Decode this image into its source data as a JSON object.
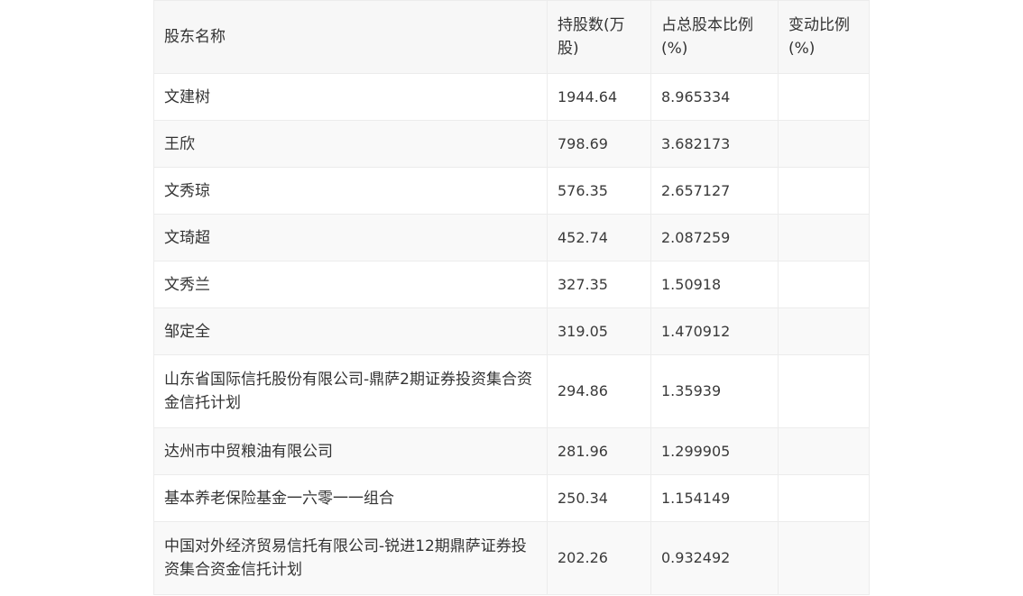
{
  "table": {
    "headers": {
      "name": "股东名称",
      "shares": "持股数(万股)",
      "ratio": "占总股本比例(%)",
      "change": "变动比例(%)"
    },
    "rows": [
      {
        "name": "文建树",
        "shares": "1944.64",
        "ratio": "8.965334",
        "change": ""
      },
      {
        "name": "王欣",
        "shares": "798.69",
        "ratio": "3.682173",
        "change": ""
      },
      {
        "name": "文秀琼",
        "shares": "576.35",
        "ratio": "2.657127",
        "change": ""
      },
      {
        "name": "文琦超",
        "shares": "452.74",
        "ratio": "2.087259",
        "change": ""
      },
      {
        "name": "文秀兰",
        "shares": "327.35",
        "ratio": "1.50918",
        "change": ""
      },
      {
        "name": "邹定全",
        "shares": "319.05",
        "ratio": "1.470912",
        "change": ""
      },
      {
        "name": "山东省国际信托股份有限公司-鼎萨2期证券投资集合资金信托计划",
        "shares": "294.86",
        "ratio": "1.35939",
        "change": ""
      },
      {
        "name": "达州市中贸粮油有限公司",
        "shares": "281.96",
        "ratio": "1.299905",
        "change": ""
      },
      {
        "name": "基本养老保险基金一六零一一组合",
        "shares": "250.34",
        "ratio": "1.154149",
        "change": ""
      },
      {
        "name": "中国对外经济贸易信托有限公司-锐进12期鼎萨证券投资集合资金信托计划",
        "shares": "202.26",
        "ratio": "0.932492",
        "change": ""
      }
    ]
  }
}
